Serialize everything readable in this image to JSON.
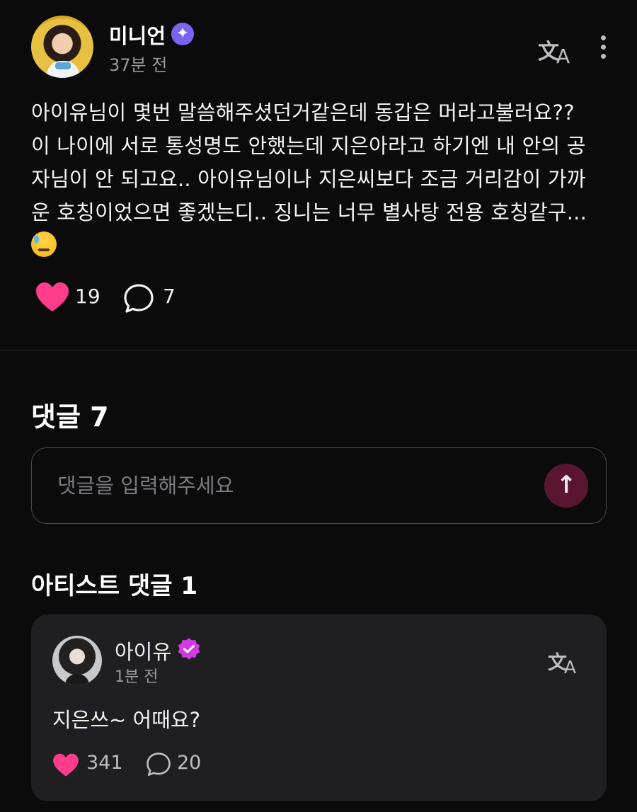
{
  "post": {
    "author": "미니언",
    "time": "37분 전",
    "body_lines": [
      "아이유님이 몇번 말씀해주셨던거같은데 동갑은 머라고불러요??",
      "이 나이에 서로 통성명도 안했는데 지은아라고 하기엔 내 안의 공",
      "자님이 안 되고요.. 아이유님이나 지은씨보다 조금 거리감이 가까",
      "운 호칭이었으면 좋겠는디.. 징니는 너무 별사탕 전용 호칭같구..."
    ],
    "likes": "19",
    "comments": "7"
  },
  "comments_section": {
    "title": "댓글 7",
    "input_placeholder": "댓글을 입력해주세요"
  },
  "artist_section": {
    "title": "아티스트 댓글 1",
    "comment": {
      "author": "아이유",
      "time": "1분 전",
      "text": "지은쓰~ 어때요?",
      "likes": "341",
      "replies": "20"
    }
  },
  "icons": {
    "translate": "translate-icon",
    "more": "more-vertical-icon",
    "like": "heart-icon",
    "comment": "comment-bubble-icon",
    "send": "arrow-up-icon",
    "verified": "verified-badge-icon"
  },
  "colors": {
    "background": "#0b0b0c",
    "heart": "#ff3d8b",
    "verified_main": "#7b63f2",
    "verified_artist": "#d23be0",
    "send_button": "#5a1630",
    "card": "#1f1f22"
  }
}
